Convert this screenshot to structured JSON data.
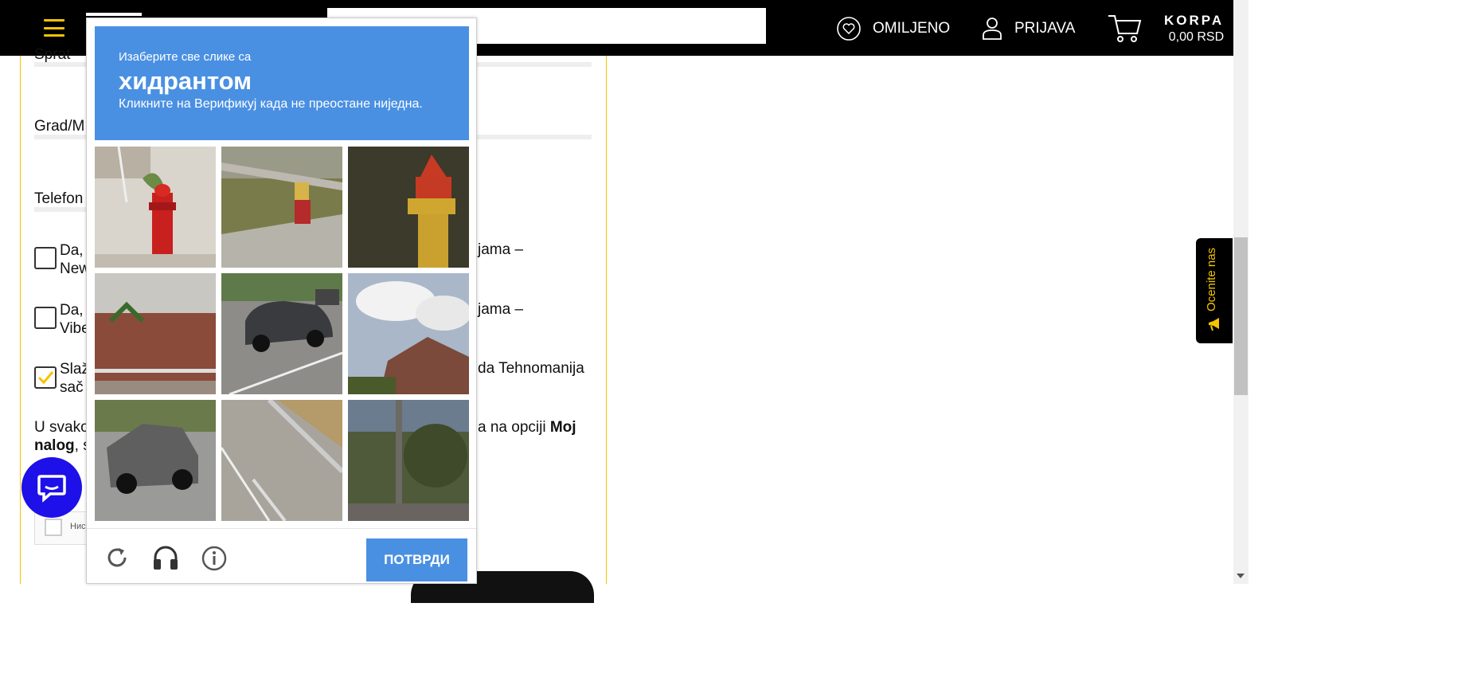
{
  "header": {
    "favorites_label": "OMILJENO",
    "login_label": "PRIJAVA",
    "cart_title": "KORPA",
    "cart_total": "0,00 RSD"
  },
  "form": {
    "floor_label": "Sprat",
    "city_label": "Grad/M",
    "phone_label": "Telefon",
    "newsletter1_left": "Da, ",
    "newsletter1_left2": "New",
    "newsletter1_right": "jama –",
    "newsletter2_left": "Da, ",
    "newsletter2_left2": "Vibe",
    "newsletter2_right": "jama –",
    "terms_left": "Slaž",
    "terms_left2": "sač",
    "terms_right": "da Tehnomanija",
    "info_left": "U svako",
    "info_right": "a na opciji",
    "info_bold1": "Moj",
    "info_bold2": "nalog",
    "info_left2": ", s",
    "recaptcha_small_text": "Нис"
  },
  "captcha": {
    "instruction_small": "Изаберите све слике са",
    "target": "хидрантом",
    "note": "Кликните на Верификуј када не преостане ниједна.",
    "verify_label": "ПОТВРДИ",
    "tiles": [
      {
        "desc": "red-hydrant"
      },
      {
        "desc": "yellow-top-hydrant"
      },
      {
        "desc": "yellow-hydrant-closeup"
      },
      {
        "desc": "brick-wall-palm"
      },
      {
        "desc": "suv-highway"
      },
      {
        "desc": "house-clouds"
      },
      {
        "desc": "silver-suv"
      },
      {
        "desc": "road-guardrail"
      },
      {
        "desc": "pole-trees"
      }
    ]
  },
  "rate_tab": {
    "label": "Ocenite nas"
  },
  "colors": {
    "accent": "#f5c400",
    "captcha_blue": "#4a90e2",
    "chat_blue": "#1d10e8"
  }
}
